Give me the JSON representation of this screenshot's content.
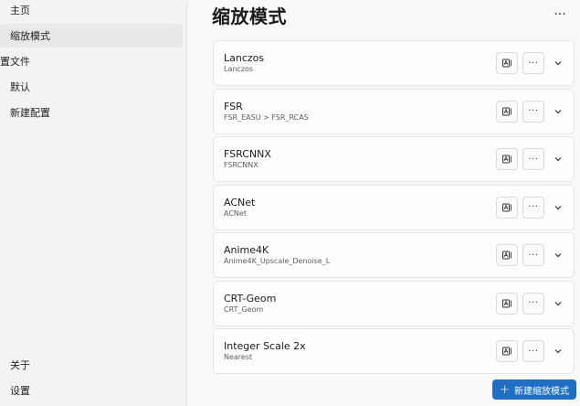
{
  "sidebar": {
    "home": "主页",
    "scaling_modes": "缩放模式",
    "profiles": "置文件",
    "default": "默认",
    "new_profile": "新建配置",
    "about": "关于",
    "settings": "设置"
  },
  "page": {
    "title": "缩放模式",
    "more": "···",
    "new_button": "新建缩放模式",
    "new_icon": "+"
  },
  "modes": [
    {
      "title": "Lanczos",
      "subtitle": "Lanczos"
    },
    {
      "title": "FSR",
      "subtitle": "FSR_EASU > FSR_RCAS"
    },
    {
      "title": "FSRCNNX",
      "subtitle": "FSRCNNX"
    },
    {
      "title": "ACNet",
      "subtitle": "ACNet"
    },
    {
      "title": "Anime4K",
      "subtitle": "Anime4K_Upscale_Denoise_L"
    },
    {
      "title": "CRT-Geom",
      "subtitle": "CRT_Geom"
    },
    {
      "title": "Integer Scale 2x",
      "subtitle": "Nearest"
    }
  ],
  "row_more": "···",
  "icons": {
    "rename": "rename-icon",
    "expand": "chevron-down-icon"
  },
  "colors": {
    "accent": "#1f6fc5",
    "sidebar_bg": "#f3f3f3",
    "card_bg": "#fdfdfd"
  }
}
